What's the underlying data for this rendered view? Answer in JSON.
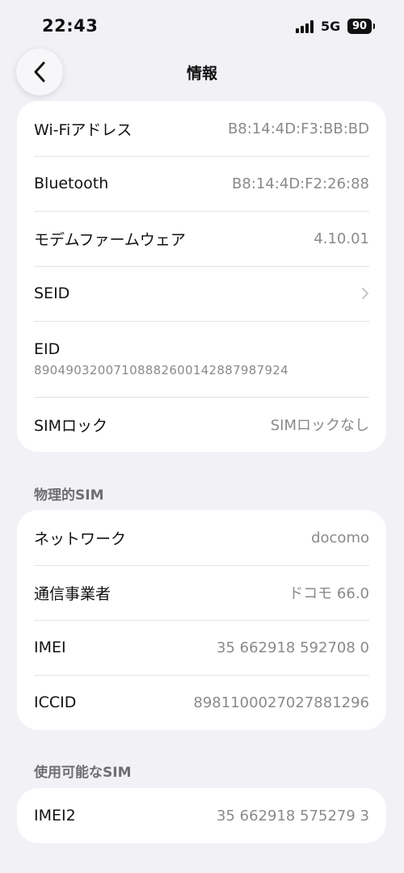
{
  "status_bar": {
    "time": "22:43",
    "network": "5G",
    "battery": "90"
  },
  "nav": {
    "title": "情報"
  },
  "info_section": {
    "rows": [
      {
        "label": "Wi-Fiアドレス",
        "value": "B8:14:4D:F3:BB:BD"
      },
      {
        "label": "Bluetooth",
        "value": "B8:14:4D:F2:26:88"
      },
      {
        "label": "モデムファームウェア",
        "value": "4.10.01"
      },
      {
        "label": "SEID",
        "value": ""
      },
      {
        "label": "EID",
        "value": "89049032007108882600142887987924"
      },
      {
        "label": "SIMロック",
        "value": "SIMロックなし"
      }
    ]
  },
  "physical_sim": {
    "header": "物理的SIM",
    "rows": [
      {
        "label": "ネットワーク",
        "value": "docomo"
      },
      {
        "label": "通信事業者",
        "value": "ドコモ 66.0"
      },
      {
        "label": "IMEI",
        "value": "35 662918 592708 0"
      },
      {
        "label": "ICCID",
        "value": "8981100027027881296"
      }
    ]
  },
  "available_sim": {
    "header": "使用可能なSIM",
    "rows": [
      {
        "label": "IMEI2",
        "value": "35 662918 575279 3"
      }
    ]
  },
  "icons": {
    "back": "chevron-left-icon",
    "disclosure": "chevron-right-icon"
  }
}
